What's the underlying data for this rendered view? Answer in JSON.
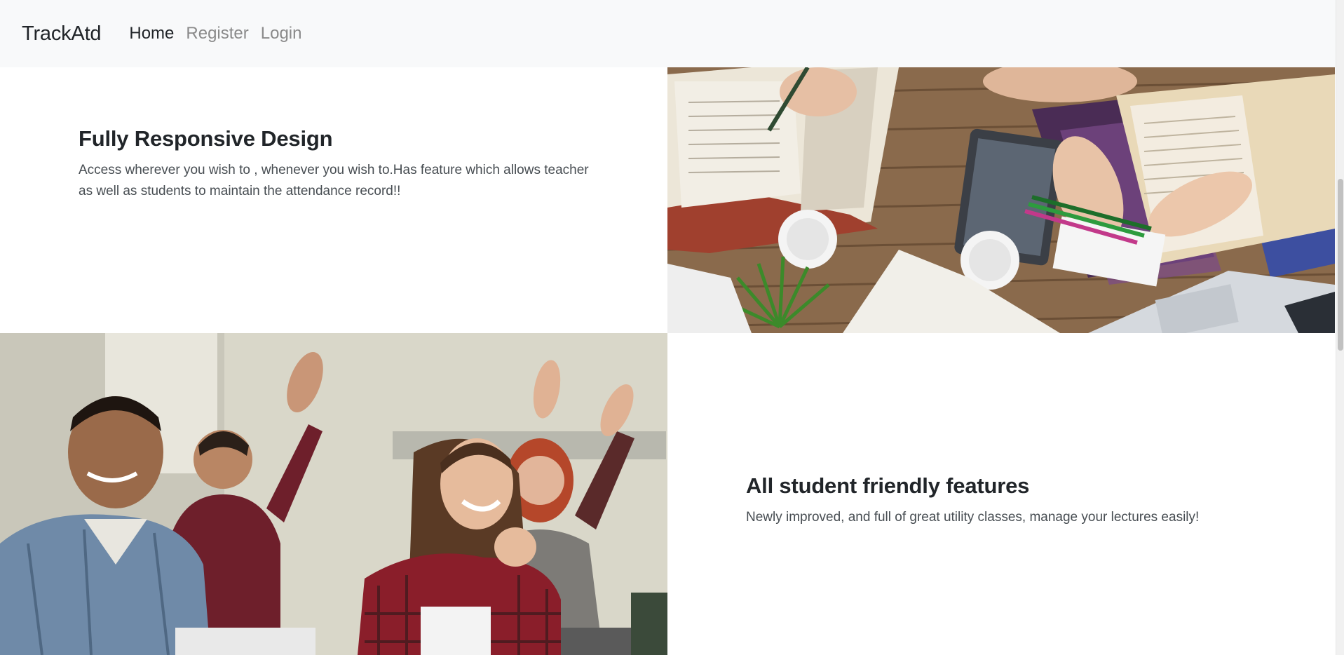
{
  "navbar": {
    "brand": "TrackAtd",
    "links": [
      {
        "label": "Home",
        "active": true
      },
      {
        "label": "Register",
        "active": false
      },
      {
        "label": "Login",
        "active": false
      }
    ]
  },
  "showcase": [
    {
      "title": "Fully Responsive Design",
      "text": "Access wherever you wish to , whenever you wish to.Has feature which allows teacher as well as students to maintain the attendance record!!",
      "image": "study-table-photo"
    },
    {
      "title": "All student friendly features",
      "text": "Newly improved, and full of great utility classes, manage your lectures easily!",
      "image": "classroom-students-photo"
    }
  ]
}
